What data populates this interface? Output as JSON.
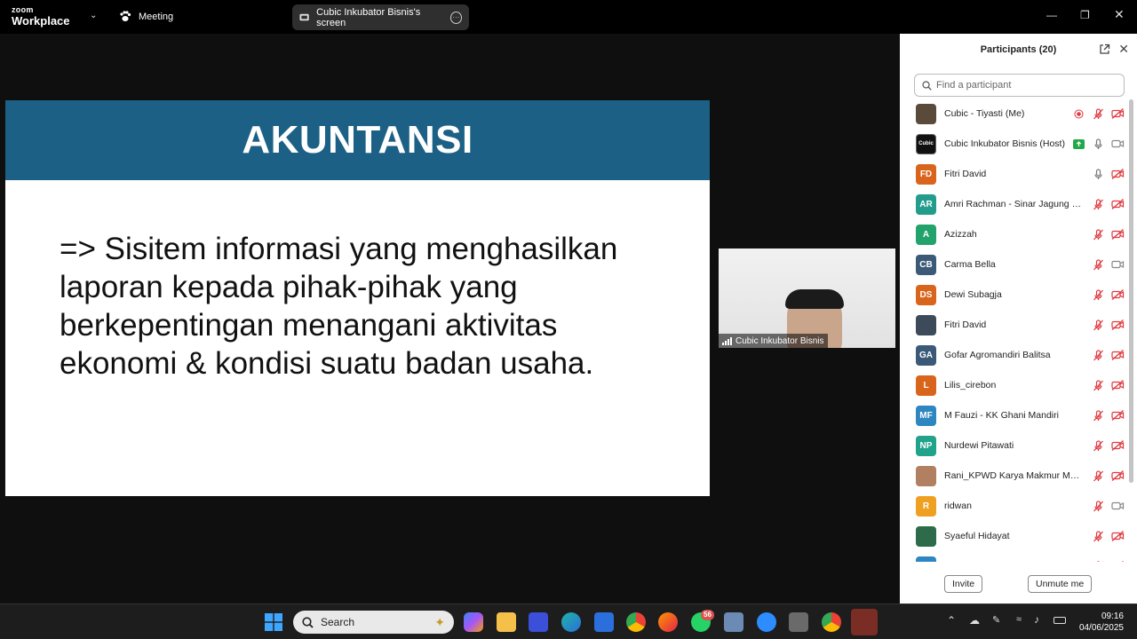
{
  "titlebar": {
    "brand_small": "zoom",
    "brand_large": "Workplace",
    "meeting_label": "Meeting",
    "share_label": "Cubic Inkubator Bisnis's screen"
  },
  "slide": {
    "title": "AKUNTANSI",
    "body": "=> Sisitem informasi yang menghasilkan laporan kepada pihak-pihak yang berkepentingan menangani aktivitas ekonomi & kondisi suatu badan usaha."
  },
  "video": {
    "name": "Cubic Inkubator Bisnis"
  },
  "panel": {
    "title": "Participants (20)",
    "search_placeholder": "Find a participant",
    "participants": [
      {
        "name": "Cubic - Tiyasti (Me)",
        "initials": "",
        "color": "#5a4a3a",
        "mic": "muted",
        "cam": "off",
        "extra": "record"
      },
      {
        "name": "Cubic Inkubator Bisnis (Host)",
        "initials": "Cubic",
        "color": "#111111",
        "mic": "on",
        "cam": "on",
        "extra": "share"
      },
      {
        "name": "Fitri David",
        "initials": "FD",
        "color": "#d9641c",
        "mic": "on",
        "cam": "off",
        "extra": ""
      },
      {
        "name": "Amri Rachman - Sinar Jagung Pr...",
        "initials": "AR",
        "color": "#239c8c",
        "mic": "muted",
        "cam": "off",
        "extra": ""
      },
      {
        "name": "Azizzah",
        "initials": "A",
        "color": "#21a36b",
        "mic": "muted",
        "cam": "off",
        "extra": ""
      },
      {
        "name": "Carma Bella",
        "initials": "CB",
        "color": "#3b5a78",
        "mic": "muted",
        "cam": "on",
        "extra": ""
      },
      {
        "name": "Dewi Subagja",
        "initials": "DS",
        "color": "#d9641c",
        "mic": "muted",
        "cam": "off",
        "extra": ""
      },
      {
        "name": "Fitri David",
        "initials": "",
        "color": "#3c4a5a",
        "mic": "muted",
        "cam": "off",
        "extra": ""
      },
      {
        "name": "Gofar Agromandiri Balitsa",
        "initials": "GA",
        "color": "#3b5a78",
        "mic": "muted",
        "cam": "off",
        "extra": ""
      },
      {
        "name": "Lilis_cirebon",
        "initials": "L",
        "color": "#d9641c",
        "mic": "muted",
        "cam": "off",
        "extra": ""
      },
      {
        "name": "M Fauzi - KK Ghani Mandiri",
        "initials": "MF",
        "color": "#2e86c1",
        "mic": "muted",
        "cam": "off",
        "extra": ""
      },
      {
        "name": "Nurdewi Pitawati",
        "initials": "NP",
        "color": "#21a38b",
        "mic": "muted",
        "cam": "off",
        "extra": ""
      },
      {
        "name": "Rani_KPWD Karya Makmur Man...",
        "initials": "",
        "color": "#b08060",
        "mic": "muted",
        "cam": "off",
        "extra": ""
      },
      {
        "name": "ridwan",
        "initials": "R",
        "color": "#f0a020",
        "mic": "muted",
        "cam": "on",
        "extra": ""
      },
      {
        "name": "Syaeful Hidayat",
        "initials": "",
        "color": "#2e6b4a",
        "mic": "muted",
        "cam": "off",
        "extra": ""
      },
      {
        "name": "",
        "initials": "",
        "color": "#2e86c1",
        "mic": "muted",
        "cam": "off",
        "extra": ""
      }
    ],
    "invite_label": "Invite",
    "unmute_label": "Unmute me"
  },
  "taskbar": {
    "search_label": "Search",
    "whatsapp_badge": "56",
    "time": "09:16",
    "date": "04/06/2025"
  }
}
